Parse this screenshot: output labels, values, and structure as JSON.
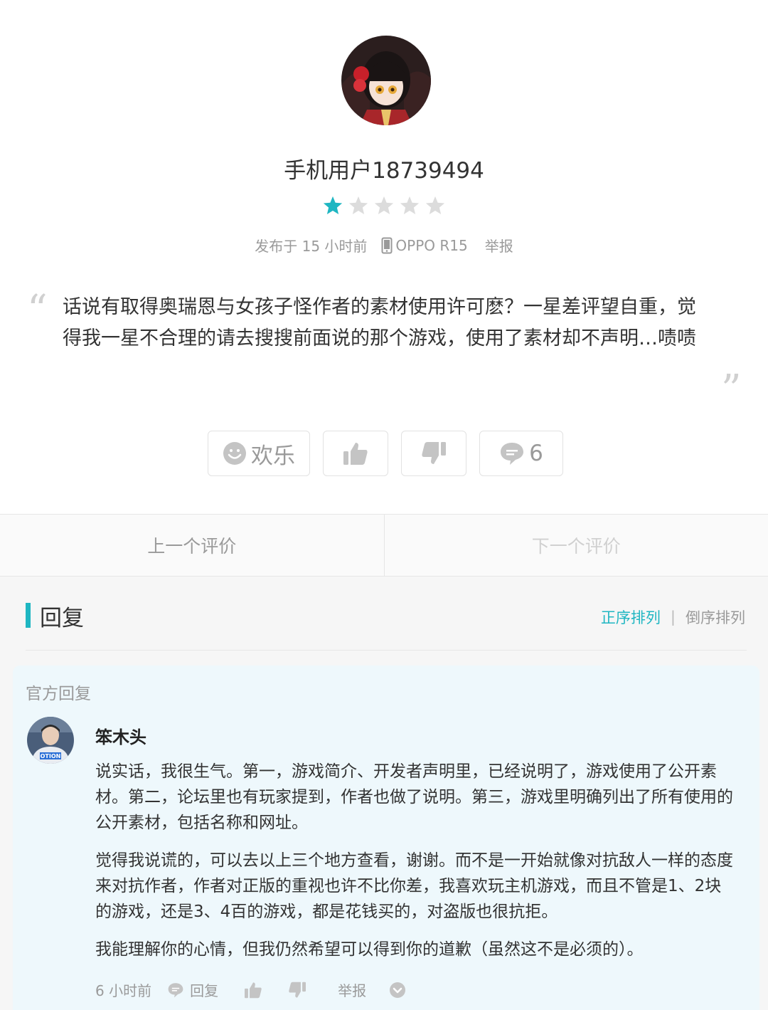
{
  "review": {
    "username": "手机用户18739494",
    "rating": 1,
    "max_rating": 5,
    "posted": "发布于 15 小时前",
    "device": "OPPO R15",
    "report": "举报",
    "text": "话说有取得奥瑞恩与女孩子怪作者的素材使用许可麽？一星差评望自重，觉得我一星不合理的请去搜搜前面说的那个游戏，使用了素材却不声明…啧啧",
    "quote_open": "“",
    "quote_close": "”"
  },
  "actions": {
    "mood_label": "欢乐",
    "comment_count": "6",
    "icons": [
      "smiley-icon",
      "thumbs-up-icon",
      "thumbs-down-icon",
      "comment-icon"
    ]
  },
  "nav": {
    "prev": "上一个评价",
    "next": "下一个评价"
  },
  "replies": {
    "title": "回复",
    "sort_asc": "正序排列",
    "sort_sep": "|",
    "sort_desc": "倒序排列",
    "official": {
      "label": "官方回复",
      "author": "笨木头",
      "paragraphs": [
        "说实话，我很生气。第一，游戏简介、开发者声明里，已经说明了，游戏使用了公开素材。第二，论坛里也有玩家提到，作者也做了说明。第三，游戏里明确列出了所有使用的公开素材，包括名称和网址。",
        "觉得我说谎的，可以去以上三个地方查看，谢谢。而不是一开始就像对抗敌人一样的态度来对抗作者，作者对正版的重视也许不比你差，我喜欢玩主机游戏，而且不管是1、2块的游戏，还是3、4百的游戏，都是花钱买的，对盗版也很抗拒。",
        "我能理解你的心情，但我仍然希望可以得到你的道歉（虽然这不是必须的）。"
      ],
      "time": "6 小时前",
      "reply_label": "回复",
      "report_label": "举报"
    }
  },
  "colors": {
    "accent": "#1fb6c2",
    "muted": "#9a9a9a",
    "star_on": "#1fb6c2",
    "star_off": "#dcdcdc",
    "official_bg": "#eef8fc"
  }
}
